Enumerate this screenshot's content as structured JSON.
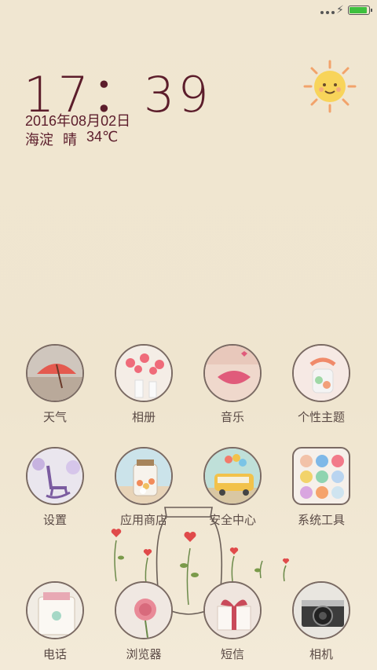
{
  "status_bar": {
    "battery_level": 0.85
  },
  "lockscreen": {
    "time": "17：39",
    "date": "2016年08月02日",
    "location": "海淀",
    "weather": "晴",
    "temperature": "34℃"
  },
  "apps": {
    "row1": [
      {
        "label": "天气"
      },
      {
        "label": "相册"
      },
      {
        "label": "音乐"
      },
      {
        "label": "个性主题"
      }
    ],
    "row2": [
      {
        "label": "设置"
      },
      {
        "label": "应用商店"
      },
      {
        "label": "安全中心"
      },
      {
        "label": "系统工具"
      }
    ],
    "dock": [
      {
        "label": "电话"
      },
      {
        "label": "浏览器"
      },
      {
        "label": "短信"
      },
      {
        "label": "相机"
      }
    ]
  }
}
